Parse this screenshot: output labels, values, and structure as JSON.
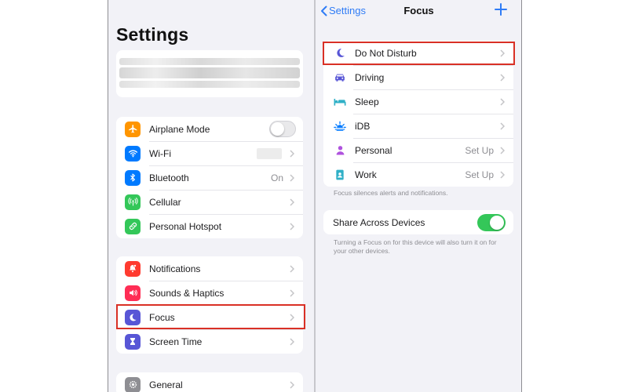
{
  "settings": {
    "title": "Settings",
    "connectivity": [
      {
        "id": "airplane",
        "label": "Airplane Mode",
        "icon": "airplane-icon",
        "color": "#ff9500",
        "control": "toggle",
        "toggle_on": false
      },
      {
        "id": "wifi",
        "label": "Wi-Fi",
        "icon": "wifi-icon",
        "color": "#007aff",
        "control": "chevron",
        "value": ""
      },
      {
        "id": "bluetooth",
        "label": "Bluetooth",
        "icon": "bluetooth-icon",
        "color": "#007aff",
        "control": "chevron",
        "value": "On"
      },
      {
        "id": "cellular",
        "label": "Cellular",
        "icon": "antenna-icon",
        "color": "#34c759",
        "control": "chevron",
        "value": ""
      },
      {
        "id": "hotspot",
        "label": "Personal Hotspot",
        "icon": "link-icon",
        "color": "#34c759",
        "control": "chevron",
        "value": ""
      }
    ],
    "notifications_group": [
      {
        "id": "notifications",
        "label": "Notifications",
        "icon": "bell-icon",
        "color": "#ff3b30",
        "control": "chevron",
        "value": ""
      },
      {
        "id": "sounds",
        "label": "Sounds & Haptics",
        "icon": "speaker-icon",
        "color": "#ff2d55",
        "control": "chevron",
        "value": ""
      },
      {
        "id": "focus",
        "label": "Focus",
        "icon": "moon-icon",
        "color": "#5856d6",
        "control": "chevron",
        "value": ""
      },
      {
        "id": "screentime",
        "label": "Screen Time",
        "icon": "hourglass-icon",
        "color": "#5856d6",
        "control": "chevron",
        "value": ""
      }
    ],
    "general_group": [
      {
        "id": "general",
        "label": "General",
        "icon": "gear-icon",
        "color": "#8e8e93",
        "control": "chevron",
        "value": ""
      }
    ]
  },
  "focus": {
    "back_label": "Settings",
    "title": "Focus",
    "modes": [
      {
        "id": "dnd",
        "label": "Do Not Disturb",
        "icon": "moon-icon",
        "color": "#5856d6",
        "value": ""
      },
      {
        "id": "driving",
        "label": "Driving",
        "icon": "car-icon",
        "color": "#5856d6",
        "value": ""
      },
      {
        "id": "sleep",
        "label": "Sleep",
        "icon": "bed-icon",
        "color": "#30b0c7",
        "value": ""
      },
      {
        "id": "idb",
        "label": "iDB",
        "icon": "sunrise-icon",
        "color": "#007aff",
        "value": ""
      },
      {
        "id": "personal",
        "label": "Personal",
        "icon": "person-icon",
        "color": "#af52de",
        "value": "Set Up"
      },
      {
        "id": "work",
        "label": "Work",
        "icon": "badge-icon",
        "color": "#30b0c7",
        "value": "Set Up"
      }
    ],
    "modes_footnote": "Focus silences alerts and notifications.",
    "share_label": "Share Across Devices",
    "share_on": true,
    "share_footnote": "Turning a Focus on for this device will also turn it on for your other devices."
  },
  "colors": {
    "accent": "#2f7cf6",
    "highlight": "#d93025",
    "toggle_on": "#34c759"
  }
}
